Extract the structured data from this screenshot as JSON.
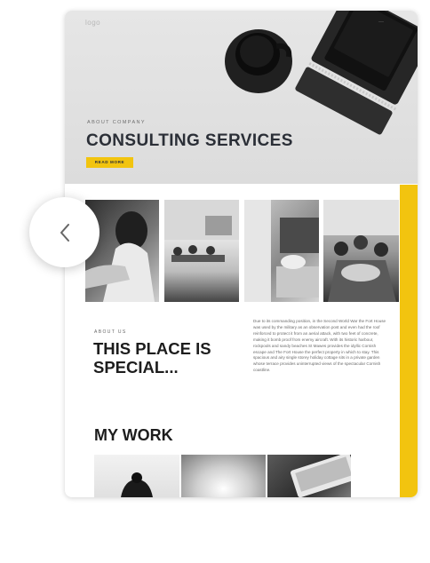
{
  "preview": {
    "logo": "logo",
    "menu": "···",
    "hero": {
      "eyebrow": "ABOUT COMPANY",
      "title": "CONSULTING SERVICES",
      "cta": "READ MORE"
    },
    "about": {
      "eyebrow": "ABOUT US",
      "title": "THIS PLACE IS SPECIAL...",
      "body": "Due to its commanding position, in the Second World War the Fort House was used by the military as an observation post and even had the roof reinforced to protect it from an aerial attack, with two feet of concrete, making it bomb proof from enemy aircraft. With its historic harbour, rockpools and sandy beaches St Mawes provides the idyllic Cornish escape and The Fort House the perfect property in which to stay. This spacious and airy single storey holiday cottage sits in a private garden whose terrace provides uninterrupted views of the spectacular Cornish coastline."
    },
    "work": {
      "title": "MY WORK"
    }
  },
  "navigation": {
    "back_icon": "chevron-left-icon"
  },
  "colors": {
    "accent": "#f2c40f",
    "heading": "#1d1d1d"
  }
}
